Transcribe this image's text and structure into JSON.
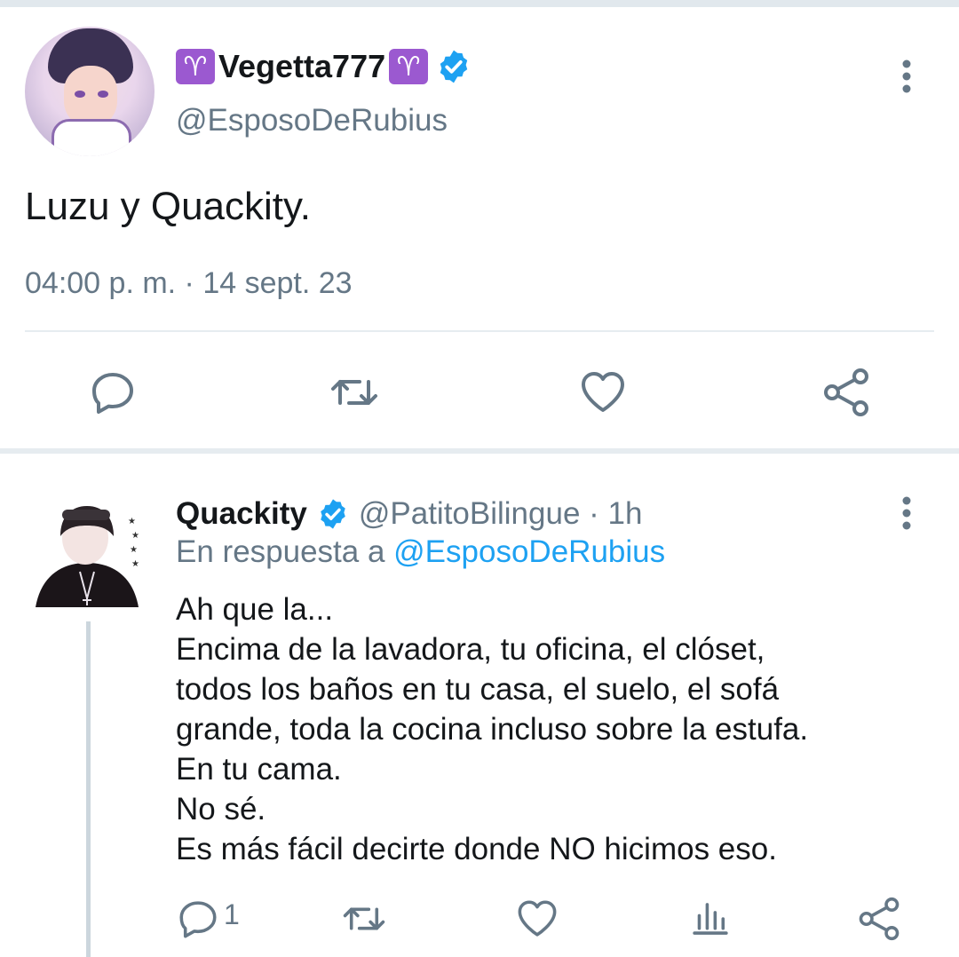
{
  "main_tweet": {
    "display_name": "Vegetta777",
    "aries_symbol": "♈",
    "handle": "@EsposoDeRubius",
    "text": "Luzu y Quackity.",
    "timestamp": "04:00 p. m. · 14 sept. 23",
    "icons": [
      "more-vertical-icon",
      "reply-icon",
      "retweet-icon",
      "like-icon",
      "share-icon"
    ]
  },
  "reply_tweet": {
    "display_name": "Quackity",
    "handle": "@PatitoBilingue · 1h",
    "in_reply_prefix": "En respuesta a ",
    "in_reply_mention": "@EsposoDeRubius",
    "lines": [
      "Ah que la...",
      "Encima de la lavadora, tu oficina, el clóset,",
      "todos los baños en tu casa, el suelo, el sofá",
      "grande, toda la cocina incluso sobre la estufa.",
      "En tu cama.",
      "No sé.",
      "Es más fácil decirte donde NO hicimos eso."
    ],
    "reply_count": "1",
    "icons": [
      "reply-icon",
      "retweet-icon",
      "like-icon",
      "stats-icon",
      "share-icon"
    ]
  },
  "colors": {
    "text": "#14171a",
    "secondary": "#657786",
    "link": "#1da1f2",
    "verified": "#1da1f2",
    "aries_badge": "#9b59d0",
    "divider": "#e6ecf0"
  }
}
